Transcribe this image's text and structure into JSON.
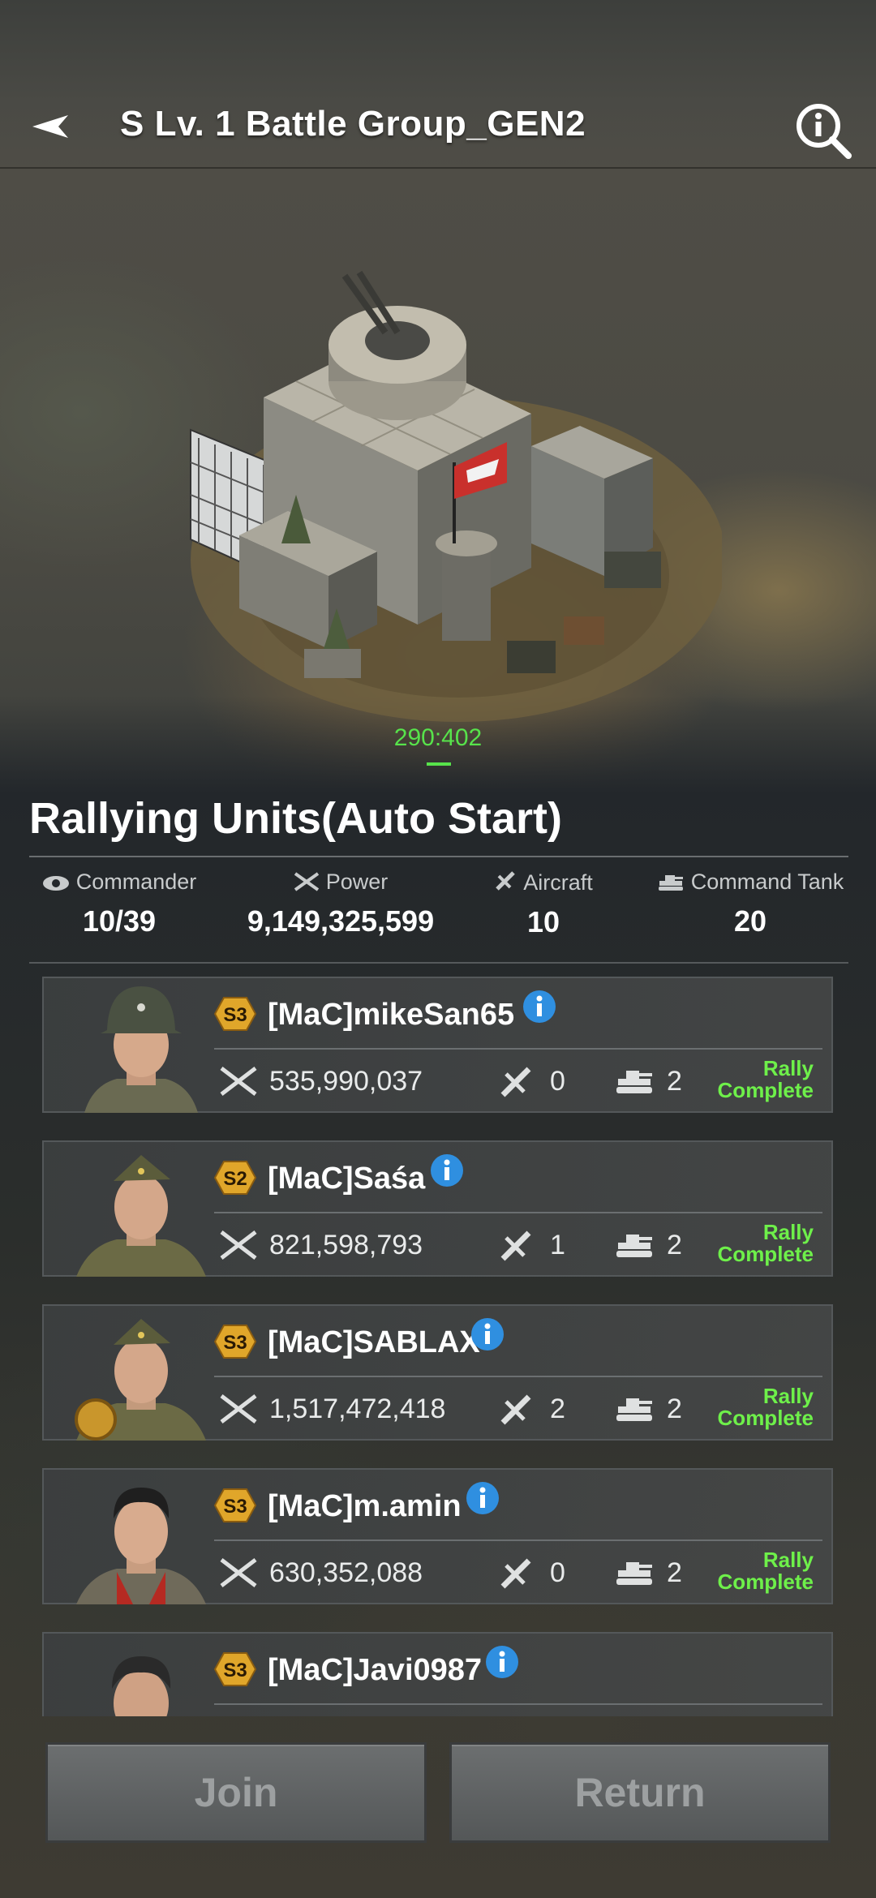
{
  "header": {
    "title": "S Lv. 1 Battle Group_GEN2",
    "back_icon": "back-arrow-icon",
    "info_icon": "info-magnifier-icon"
  },
  "location": {
    "coords": "290:402"
  },
  "rally": {
    "title": "Rallying Units(Auto Start)",
    "stats": [
      {
        "label": "Commander",
        "value": "10/39",
        "icon": "eye-icon"
      },
      {
        "label": "Power",
        "value": "9,149,325,599",
        "icon": "crossed-rifles-icon"
      },
      {
        "label": "Aircraft",
        "value": "10",
        "icon": "plane-icon"
      },
      {
        "label": "Command Tank",
        "value": "20",
        "icon": "tank-icon"
      }
    ]
  },
  "members": [
    {
      "season": "S3",
      "name": "[MaC]mikeSan65",
      "power": "535,990,037",
      "aircraft": "0",
      "tanks": "2",
      "status_line1": "Rally",
      "status_line2": "Complete"
    },
    {
      "season": "S2",
      "name": "[MaC]Saśa",
      "power": "821,598,793",
      "aircraft": "1",
      "tanks": "2",
      "status_line1": "Rally",
      "status_line2": "Complete"
    },
    {
      "season": "S3",
      "name": "[MaC]SABLAX",
      "power": "1,517,472,418",
      "aircraft": "2",
      "tanks": "2",
      "status_line1": "Rally",
      "status_line2": "Complete"
    },
    {
      "season": "S3",
      "name": "[MaC]m.amin",
      "power": "630,352,088",
      "aircraft": "0",
      "tanks": "2",
      "status_line1": "Rally",
      "status_line2": "Complete"
    },
    {
      "season": "S3",
      "name": "[MaC]Javi0987"
    }
  ],
  "buttons": {
    "join": "Join",
    "return": "Return"
  },
  "colors": {
    "accent_green": "#6ef04a",
    "coords_green": "#57e34b",
    "badge_gold": "#e0a62a"
  }
}
